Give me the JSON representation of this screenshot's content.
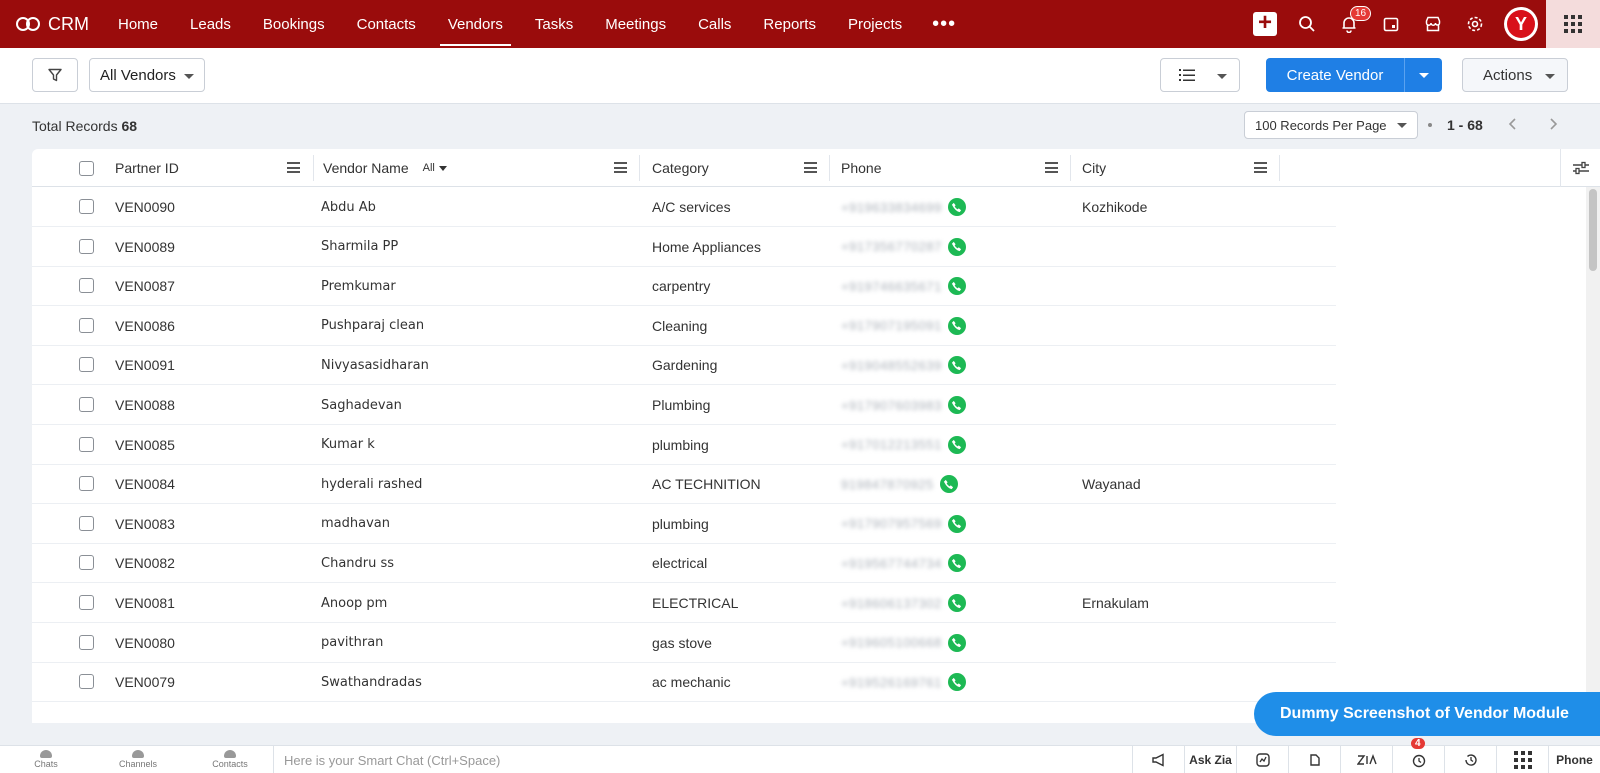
{
  "nav": {
    "brand": "CRM",
    "items": [
      "Home",
      "Leads",
      "Bookings",
      "Contacts",
      "Vendors",
      "Tasks",
      "Meetings",
      "Calls",
      "Reports",
      "Projects"
    ],
    "active": "Vendors",
    "more": "•••",
    "notification_count": "16",
    "avatar_letter": "Y"
  },
  "toolbar": {
    "view_label": "All Vendors",
    "create_label": "Create Vendor",
    "actions_label": "Actions"
  },
  "records": {
    "total_label": "Total Records",
    "total_count": "68",
    "per_page": "100 Records Per Page",
    "range": "1 - 68"
  },
  "table": {
    "columns": [
      "Partner ID",
      "Vendor Name",
      "Category",
      "Phone",
      "City"
    ],
    "vendor_filter": "All",
    "rows": [
      {
        "id": "VEN0090",
        "name": "Abdu Ab",
        "category": "A/C services",
        "phone": "+919633834699",
        "city": "Kozhikode"
      },
      {
        "id": "VEN0089",
        "name": "Sharmila PP",
        "category": "Home Appliances",
        "phone": "+917356770287",
        "city": ""
      },
      {
        "id": "VEN0087",
        "name": "Premkumar",
        "category": "carpentry",
        "phone": "+919746635671",
        "city": ""
      },
      {
        "id": "VEN0086",
        "name": "Pushparaj clean",
        "category": "Cleaning",
        "phone": "+917907195091",
        "city": ""
      },
      {
        "id": "VEN0091",
        "name": "Nivyasasidharan",
        "category": "Gardening",
        "phone": "+919048552639",
        "city": ""
      },
      {
        "id": "VEN0088",
        "name": "Saghadevan",
        "category": "Plumbing",
        "phone": "+917907603983",
        "city": ""
      },
      {
        "id": "VEN0085",
        "name": "Kumar k",
        "category": "plumbing",
        "phone": "+917012213551",
        "city": ""
      },
      {
        "id": "VEN0084",
        "name": "hyderali rashed",
        "category": "AC TECHNITION",
        "phone": "919847870925",
        "city": "Wayanad"
      },
      {
        "id": "VEN0083",
        "name": "madhavan",
        "category": "plumbing",
        "phone": "+917907957569",
        "city": ""
      },
      {
        "id": "VEN0082",
        "name": "Chandru ss",
        "category": "electrical",
        "phone": "+919567744734",
        "city": ""
      },
      {
        "id": "VEN0081",
        "name": "Anoop pm",
        "category": "ELECTRICAL",
        "phone": "+918606137302",
        "city": "Ernakulam"
      },
      {
        "id": "VEN0080",
        "name": "pavithran",
        "category": "gas stove",
        "phone": "+919605100668",
        "city": ""
      },
      {
        "id": "VEN0079",
        "name": "Swathandradas",
        "category": "ac mechanic",
        "phone": "+919526169761",
        "city": ""
      }
    ]
  },
  "watermark": "Dummy Screenshot of Vendor Module",
  "bottombar": {
    "items": [
      "Chats",
      "Channels",
      "Contacts"
    ],
    "smartchat_placeholder": "Here is your Smart Chat (Ctrl+Space)",
    "ask_zia": "Ask Zia",
    "alarm_count": "4",
    "phone_label": "Phone"
  },
  "colors": {
    "nav_bg": "#9a0c0c",
    "primary": "#1f7fe5",
    "call": "#1db954"
  }
}
